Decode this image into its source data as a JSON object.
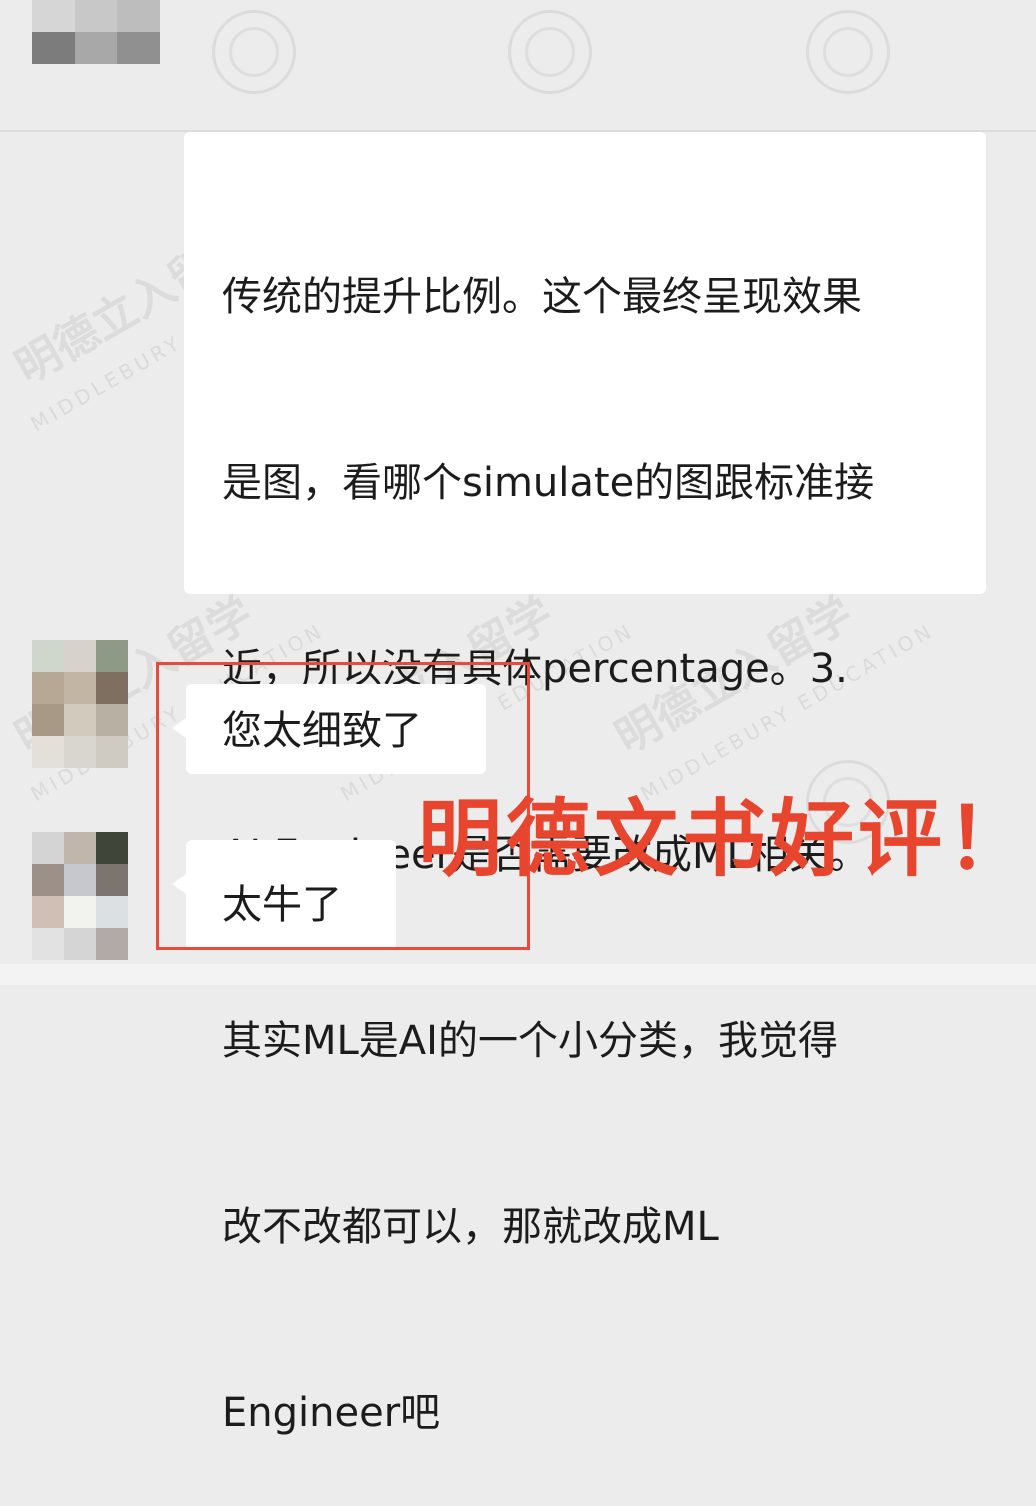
{
  "messages": [
    {
      "lines": [
        "传统的提升比例。这个最终呈现效果",
        "是图，看哪个simulate的图跟标准接",
        "近，所以没有具体percentage。3.",
        "AI Engineer是否需要改成ML相关。",
        "其实ML是AI的一个小分类，我觉得",
        "改不改都可以，那就改成ML",
        "Engineer吧"
      ]
    },
    {
      "text": "您太细致了"
    },
    {
      "text": "太牛了"
    }
  ],
  "caption": "明德文书好评！",
  "watermark": {
    "cn": "明德立入留学",
    "en": "MIDDLEBURY EDUCATION"
  },
  "colors": {
    "background": "#ececec",
    "bubble": "#ffffff",
    "highlight": "#e84a3c",
    "caption": "#e8452f"
  }
}
